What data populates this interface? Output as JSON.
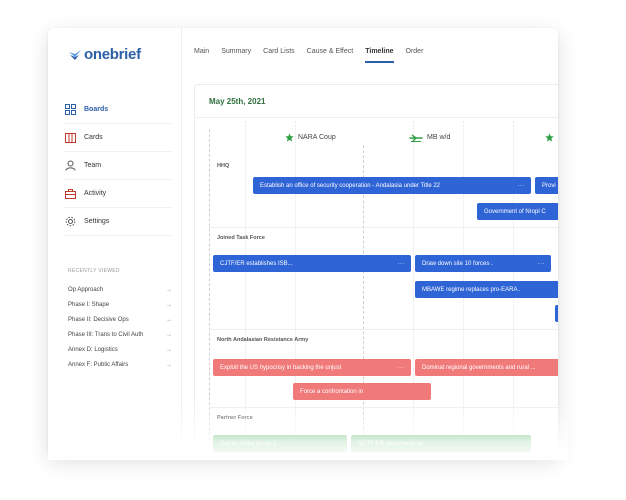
{
  "app": {
    "logo_text": "onebrief",
    "brand_color": "#2b5fa6"
  },
  "tabs": [
    {
      "label": "Main"
    },
    {
      "label": "Summary"
    },
    {
      "label": "Card Lists"
    },
    {
      "label": "Cause & Effect"
    },
    {
      "label": "Timeline",
      "active": true
    },
    {
      "label": "Order"
    }
  ],
  "sidebar": {
    "items": [
      {
        "label": "Boards",
        "icon": "boards-icon",
        "active": true
      },
      {
        "label": "Cards",
        "icon": "cards-icon"
      },
      {
        "label": "Team",
        "icon": "team-icon"
      },
      {
        "label": "Activity",
        "icon": "activity-icon"
      },
      {
        "label": "Settings",
        "icon": "settings-icon"
      }
    ],
    "recent_title": "RECENTLY VIEWED",
    "recent": [
      {
        "label": "Op Approach",
        "arrow": "→"
      },
      {
        "label": "Phase I: Shape",
        "arrow": "→"
      },
      {
        "label": "Phase II: Decisive Ops",
        "arrow": "→"
      },
      {
        "label": "Phase III: Trans to Civil Auth",
        "arrow": "→"
      },
      {
        "label": "Annex D: Logistics",
        "arrow": "→"
      },
      {
        "label": "Annex F: Public Affairs",
        "arrow": "→"
      }
    ]
  },
  "timeline": {
    "date": "May 25th, 2021",
    "markers": [
      {
        "label": "NARA Coup",
        "icon": "star-icon"
      },
      {
        "label": "MB w/d",
        "icon": "aircraft-icon"
      },
      {
        "label": "",
        "icon": "star-icon"
      }
    ],
    "groups": [
      {
        "label": "HHQ"
      },
      {
        "label": "Joined Task Force"
      },
      {
        "label": "North Andalasian Resistance Army"
      },
      {
        "label": "Partner Force"
      }
    ],
    "cards": [
      {
        "text": "Establish an office of security cooperation - Andalasia under Title 22",
        "color": "blue",
        "more": "···"
      },
      {
        "text": "Provi",
        "color": "blue",
        "more": ""
      },
      {
        "text": "Government of Nropl C",
        "color": "blue",
        "more": ""
      },
      {
        "text": "CJTF/ER establishes ISB...",
        "color": "blue",
        "more": "···"
      },
      {
        "text": "Draw down site 10 forces .",
        "color": "blue",
        "more": "···"
      },
      {
        "text": "MBAWE regime replaces pro-EARA .",
        "color": "blue",
        "more": ""
      },
      {
        "text": "",
        "color": "blue",
        "more": ""
      },
      {
        "text": "Exploit the US hypocrisy in backing the unjust",
        "color": "red",
        "more": "···"
      },
      {
        "text": "Dominat regional governments and rural ...",
        "color": "red",
        "more": "···"
      },
      {
        "text": "Force a confrontation in",
        "color": "red",
        "more": ""
      },
      {
        "text": "Carrier strike group 2",
        "color": "green",
        "more": "···"
      },
      {
        "text": "SOTF/ER documents an",
        "color": "green",
        "more": "···"
      }
    ],
    "colors": {
      "blue": "#2f64d6",
      "red": "#f07a7a",
      "green": "#3faa52",
      "marker_green": "#2f9e44"
    }
  }
}
